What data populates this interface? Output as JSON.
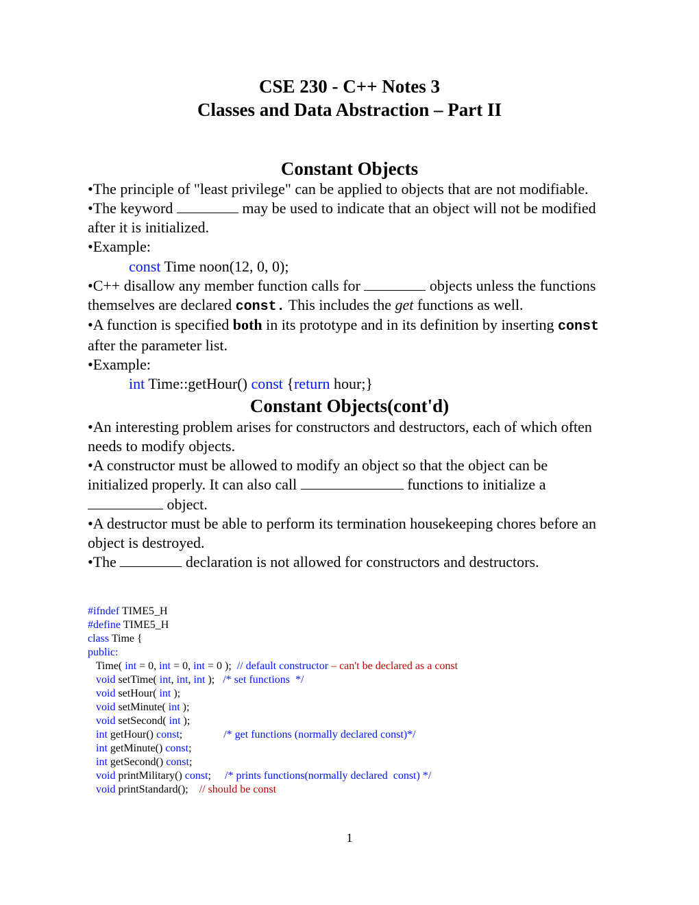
{
  "title_line1": "CSE 230 - C++ Notes 3",
  "title_line2": "Classes and Data Abstraction – Part II",
  "sec1_h": "Constant Objects",
  "sec1_p1": "•The principle of \"least privilege\" can be applied to objects that are not modifiable.",
  "sec1_p2a": "•The keyword ",
  "sec1_p2b": " may be used to indicate that an object will not be modified after it is initialized.",
  "sec1_p3": "•Example:",
  "sec1_ex1_kw": "const",
  "sec1_ex1_rest": " Time noon(12, 0, 0);",
  "sec1_p4a": "•C++ disallow any member function calls for ",
  "sec1_p4b": " objects unless the functions themselves are declared ",
  "sec1_p4_const": "const.",
  "sec1_p4c": "  This includes the ",
  "sec1_p4_get": "get",
  "sec1_p4d": " functions as well.",
  "sec1_p5a": "•A function is specified ",
  "sec1_p5_both": "both",
  "sec1_p5b": " in its prototype and in its definition by inserting ",
  "sec1_p5_const": "const",
  "sec1_p5c": "  after the parameter list.",
  "sec1_p6": "•Example:",
  "sec1_ex2_int": "int",
  "sec1_ex2_a": " Time::getHour() ",
  "sec1_ex2_const": "const",
  "sec1_ex2_b": " {",
  "sec1_ex2_return": "return",
  "sec1_ex2_c": " hour;}",
  "sec2_h": "Constant Objects(cont'd)",
  "sec2_p1": "•An interesting problem arises for constructors and destructors, each of which often needs to modify objects.",
  "sec2_p2a": "•A constructor must be allowed to modify an object so that the object can be initialized properly. It can also call ",
  "sec2_p2b": " functions to initialize a ",
  "sec2_p2c": " object.",
  "sec2_p3": "•A destructor must be able to perform its termination housekeeping chores before an object is destroyed.",
  "sec2_p4a": "•The ",
  "sec2_p4b": " declaration is not allowed for constructors and destructors.",
  "code": {
    "l1a": "#ifndef",
    "l1b": " TIME5_H",
    "l2a": "#define",
    "l2b": " TIME5_H",
    "l3a": "class",
    "l3b": " Time {",
    "l4": "public:",
    "l5a": "   Time( ",
    "l5b": "int",
    "l5c": " = 0, ",
    "l5d": "int",
    "l5e": " = 0, ",
    "l5f": "int",
    "l5g": " = 0 );  ",
    "l5h": "// default constructor",
    "l5i": " – can't be declared as a const",
    "l6a": "   ",
    "l6b": "void",
    "l6c": " setTime( ",
    "l6d": "int",
    "l6e": ", ",
    "l6f": "int",
    "l6g": ", ",
    "l6h": "int",
    "l6i": " );   ",
    "l6j": "/* set functions  */",
    "l7a": "   ",
    "l7b": "void",
    "l7c": " setHour( ",
    "l7d": "int",
    "l7e": " );",
    "l8a": "   ",
    "l8b": "void",
    "l8c": " setMinute( ",
    "l8d": "int",
    "l8e": " );",
    "l9a": "   ",
    "l9b": "void",
    "l9c": " setSecond( ",
    "l9d": "int",
    "l9e": " );",
    "l10a": "   ",
    "l10b": "int",
    "l10c": " getHour() ",
    "l10d": "const",
    "l10e": ";               ",
    "l10f": "/* get functions (normally declared const)*/",
    "l11a": "   ",
    "l11b": "int",
    "l11c": " getMinute() ",
    "l11d": "const",
    "l11e": ";",
    "l12a": "   ",
    "l12b": "int",
    "l12c": " getSecond() ",
    "l12d": "const",
    "l12e": ";",
    "l13a": "   ",
    "l13b": "void",
    "l13c": " printMilitary() ",
    "l13d": "const",
    "l13e": ";     ",
    "l13f": "/* prints functions(normally declared  const) */",
    "l14a": "   ",
    "l14b": "void",
    "l14c": " printStandard();    ",
    "l14d": "// should be const"
  },
  "page_num": "1"
}
